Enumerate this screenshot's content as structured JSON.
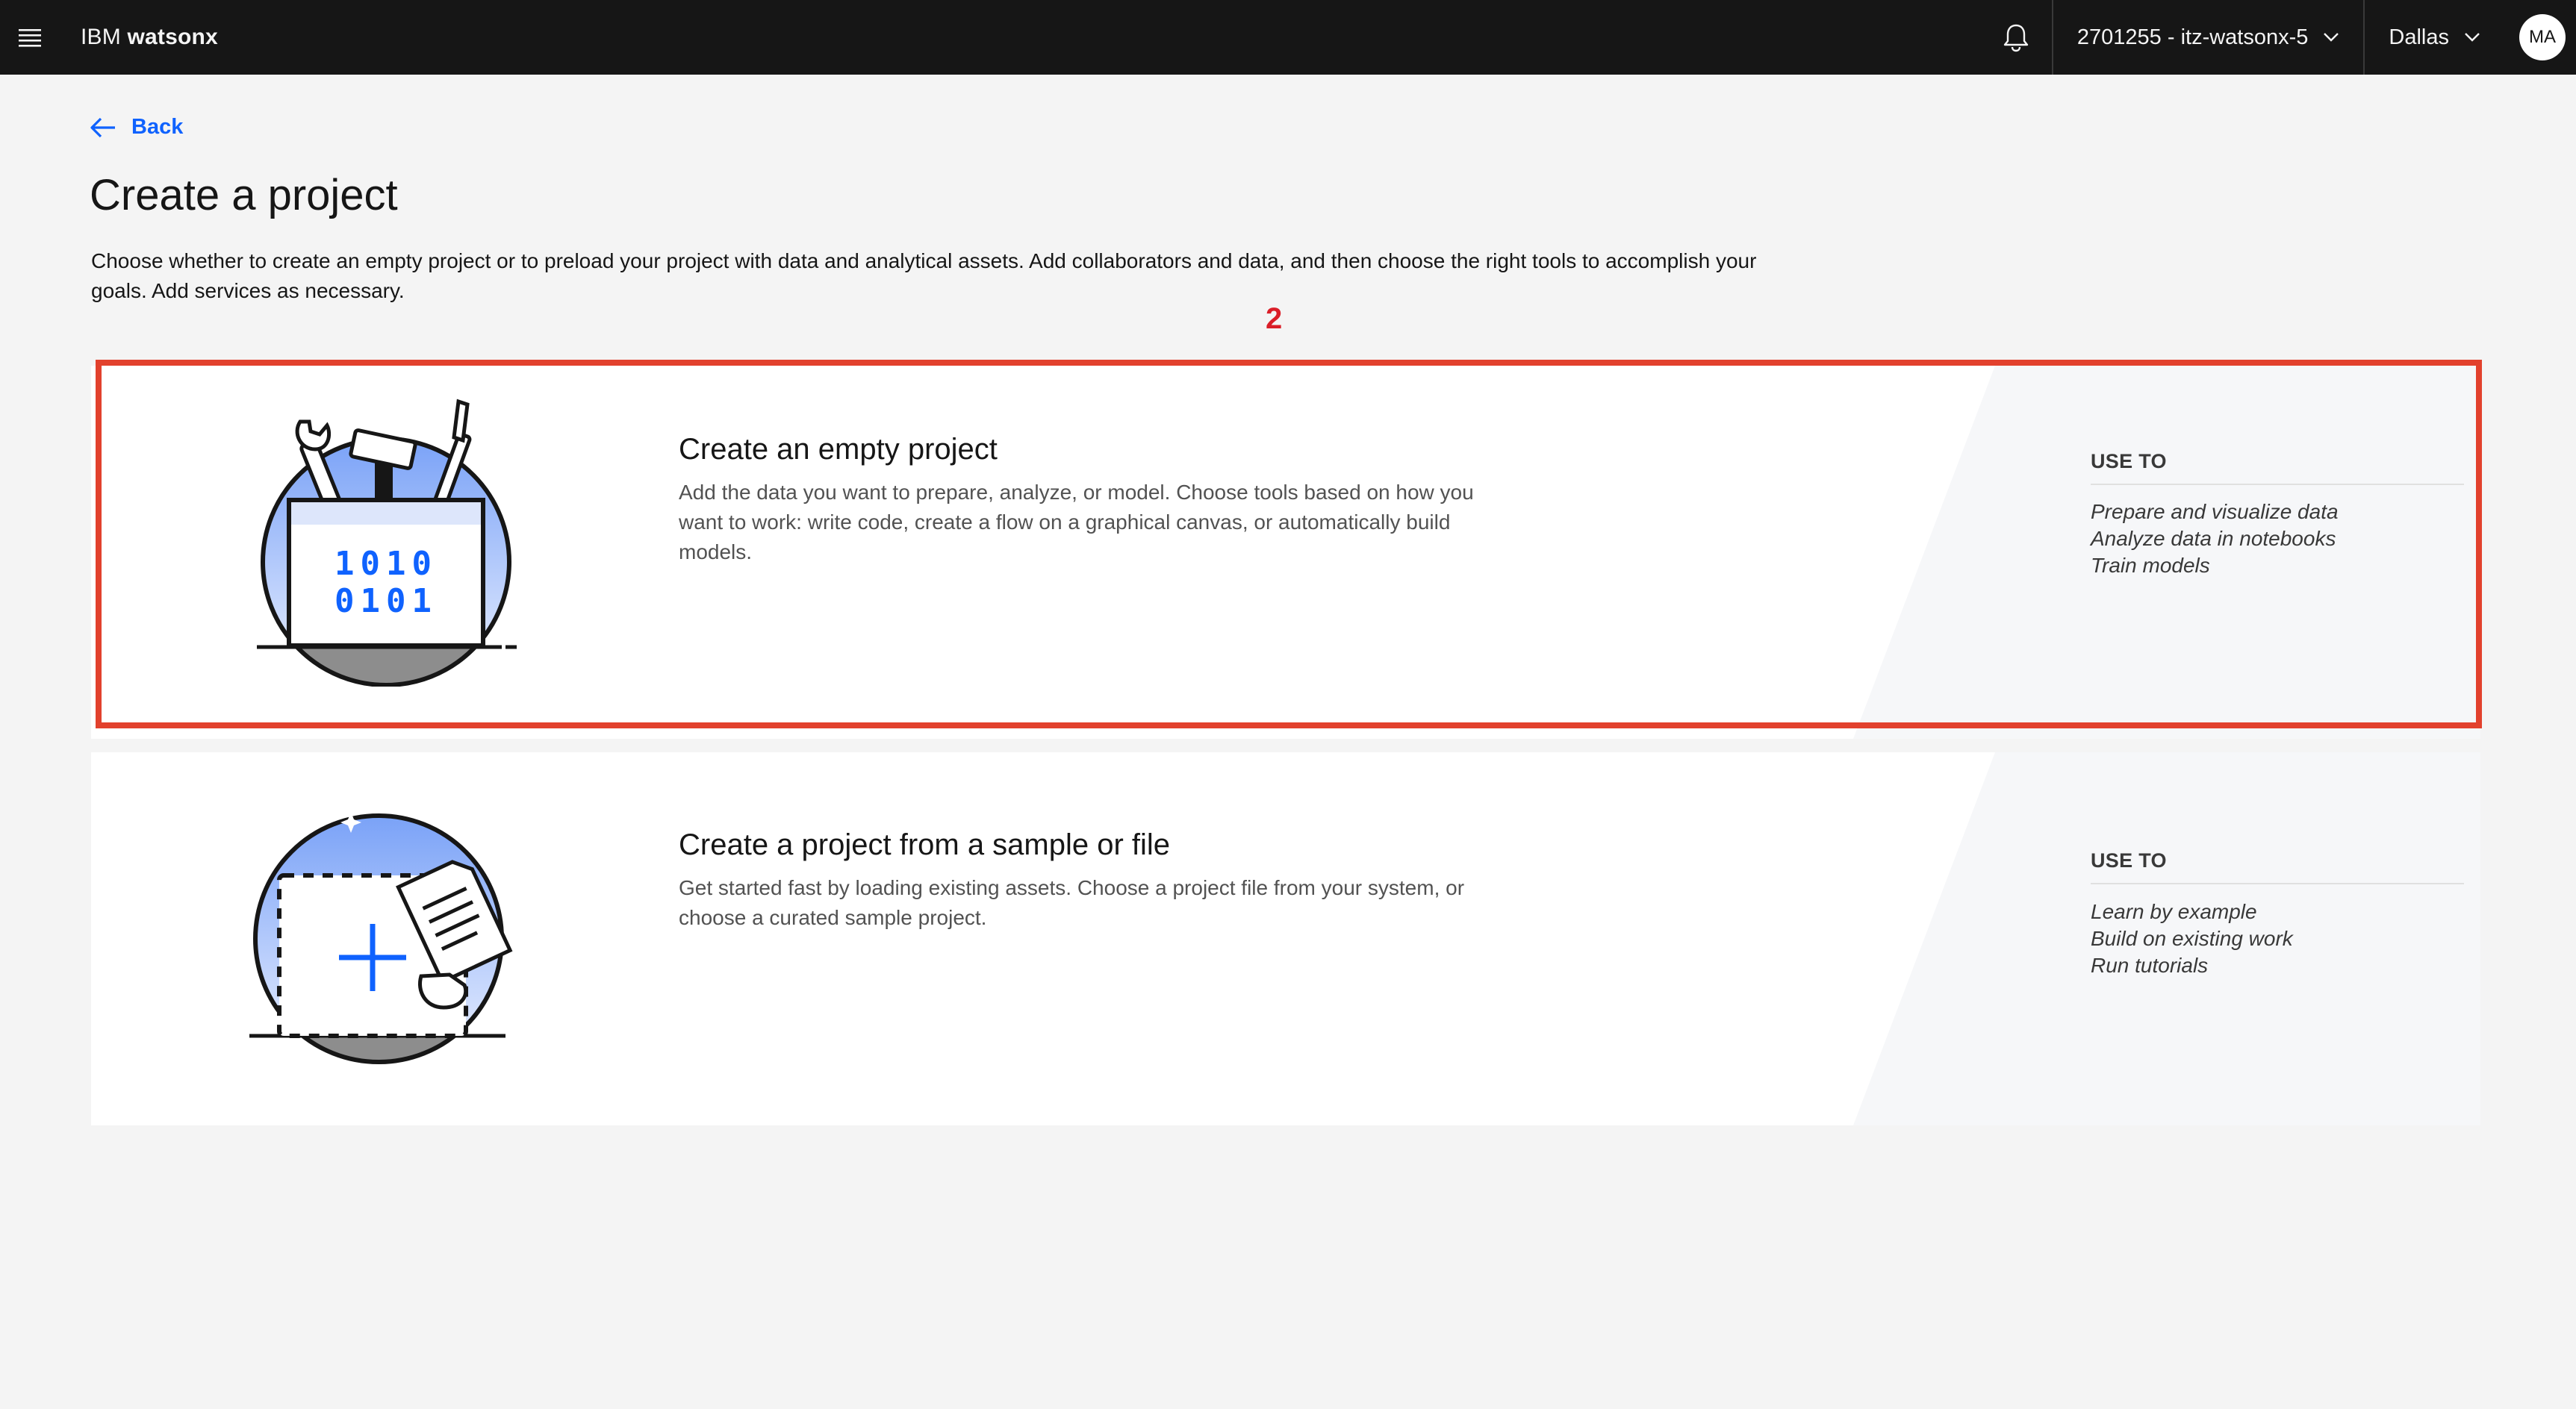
{
  "header": {
    "brand_ibm": "IBM",
    "brand_product": "watsonx",
    "account": "2701255 - itz-watsonx-5",
    "region": "Dallas",
    "avatar_initials": "MA"
  },
  "page": {
    "back_label": "Back",
    "title": "Create a project",
    "description": "Choose whether to create an empty project or to preload your project with data and analytical assets. Add collaborators and data, and then choose the right tools to accomplish your goals. Add services as necessary.",
    "annotation_step": "2"
  },
  "cards": [
    {
      "title": "Create an empty project",
      "description": "Add the data you want to prepare, analyze, or model. Choose tools based on how you want to work: write code, create a flow on a graphical canvas, or automatically build models.",
      "use_to_label": "USE TO",
      "uses": [
        "Prepare and visualize data",
        "Analyze data in notebooks",
        "Train models"
      ],
      "binary_line1": "1010",
      "binary_line2": "0101"
    },
    {
      "title": "Create a project from a sample or file",
      "description": "Get started fast by loading existing assets. Choose a project file from your system, or choose a curated sample project.",
      "use_to_label": "USE TO",
      "uses": [
        "Learn by example",
        "Build on existing work",
        "Run tutorials"
      ]
    }
  ],
  "colors": {
    "header_bg": "#161616",
    "link_blue": "#0f62fe",
    "highlight_red": "#e2412d",
    "page_bg": "#f4f4f4"
  },
  "icons": [
    "menu-icon",
    "notification-bell-icon",
    "chevron-down-icon",
    "arrow-left-icon",
    "toolbox-illustration",
    "add-file-illustration"
  ]
}
